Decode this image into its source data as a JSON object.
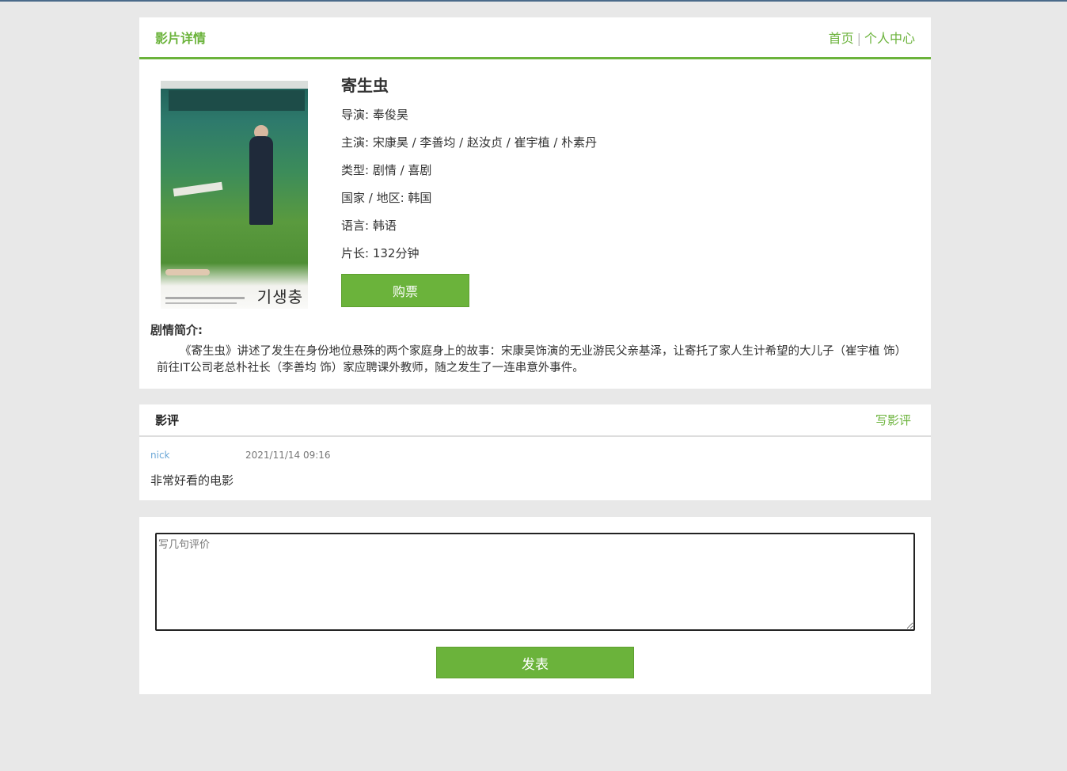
{
  "header": {
    "title": "影片详情",
    "links": {
      "home": "首页",
      "separator": "|",
      "profile": "个人中心"
    }
  },
  "movie": {
    "name": "寄生虫",
    "poster_title_kr": "기생충",
    "director": "导演: 奉俊昊",
    "cast": "主演: 宋康昊 / 李善均 / 赵汝贞 / 崔宇植 / 朴素丹",
    "genre": "类型: 剧情 / 喜剧",
    "region": "国家 / 地区: 韩国",
    "language": "语言: 韩语",
    "runtime": "片长: 132分钟",
    "buy_label": "购票"
  },
  "synopsis": {
    "label": "剧情简介:",
    "text": "《寄生虫》讲述了发生在身份地位悬殊的两个家庭身上的故事：宋康昊饰演的无业游民父亲基泽，让寄托了家人生计希望的大儿子（崔宇植 饰）前往IT公司老总朴社长（李善均 饰）家应聘课外教师，随之发生了一连串意外事件。"
  },
  "reviews": {
    "title": "影评",
    "write_label": "写影评",
    "items": [
      {
        "user": "nick",
        "time": "2021/11/14 09:16",
        "text": "非常好看的电影"
      }
    ]
  },
  "comment_form": {
    "placeholder": "写几句评价",
    "value": "",
    "submit_label": "发表"
  },
  "colors": {
    "accent": "#6bb33b",
    "background": "#e8e8e8",
    "user_link": "#6aa7d6"
  }
}
